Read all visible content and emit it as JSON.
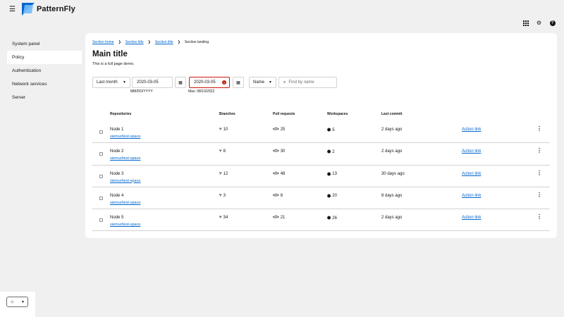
{
  "header": {
    "brand": "PatternFly"
  },
  "sidebar": {
    "items": [
      {
        "label": "System panel",
        "active": false
      },
      {
        "label": "Policy",
        "active": true
      },
      {
        "label": "Authentication",
        "active": false
      },
      {
        "label": "Network services",
        "active": false
      },
      {
        "label": "Server",
        "active": false
      }
    ]
  },
  "breadcrumb": {
    "items": [
      "Section home",
      "Section title",
      "Section title"
    ],
    "current": "Section landing"
  },
  "page": {
    "title": "Main title",
    "description": "This is a full page demo."
  },
  "toolbar": {
    "period": "Last month",
    "start_date": "2020-03-05",
    "start_helper": "MM/DD/YYYY",
    "end_date": "2020-03-05",
    "end_helper": "Max: 08/10/2022",
    "attribute": "Name",
    "search_placeholder": "Find by name"
  },
  "table": {
    "columns": [
      "Repositories",
      "Branches",
      "Pull requests",
      "Workspaces",
      "Last commit"
    ],
    "rows": [
      {
        "name": "Node 1",
        "link": "siemur/test-space",
        "branches": "10",
        "prs": "25",
        "workspaces": "5",
        "last_commit": "2 days ago",
        "action": "Action link"
      },
      {
        "name": "Node 2",
        "link": "siemur/test-space",
        "branches": "8",
        "prs": "30",
        "workspaces": "2",
        "last_commit": "2 days ago",
        "action": "Action link"
      },
      {
        "name": "Node 3",
        "link": "siemur/test-space",
        "branches": "12",
        "prs": "48",
        "workspaces": "13",
        "last_commit": "30 days ago",
        "action": "Action link"
      },
      {
        "name": "Node 4",
        "link": "siemur/test-space",
        "branches": "3",
        "prs": "8",
        "workspaces": "20",
        "last_commit": "8 days ago",
        "action": "Action link"
      },
      {
        "name": "Node 5",
        "link": "siemur/test-space",
        "branches": "34",
        "prs": "21",
        "workspaces": "26",
        "last_commit": "2 days ago",
        "action": "Action link"
      }
    ]
  },
  "icons": {
    "branch": "code-branch-icon",
    "pull_request": "code-icon",
    "workspace": "cube-icon",
    "theme": "sun-icon"
  },
  "colors": {
    "link": "#0066cc",
    "error": "#c9190b",
    "background": "#f0f0f0"
  }
}
